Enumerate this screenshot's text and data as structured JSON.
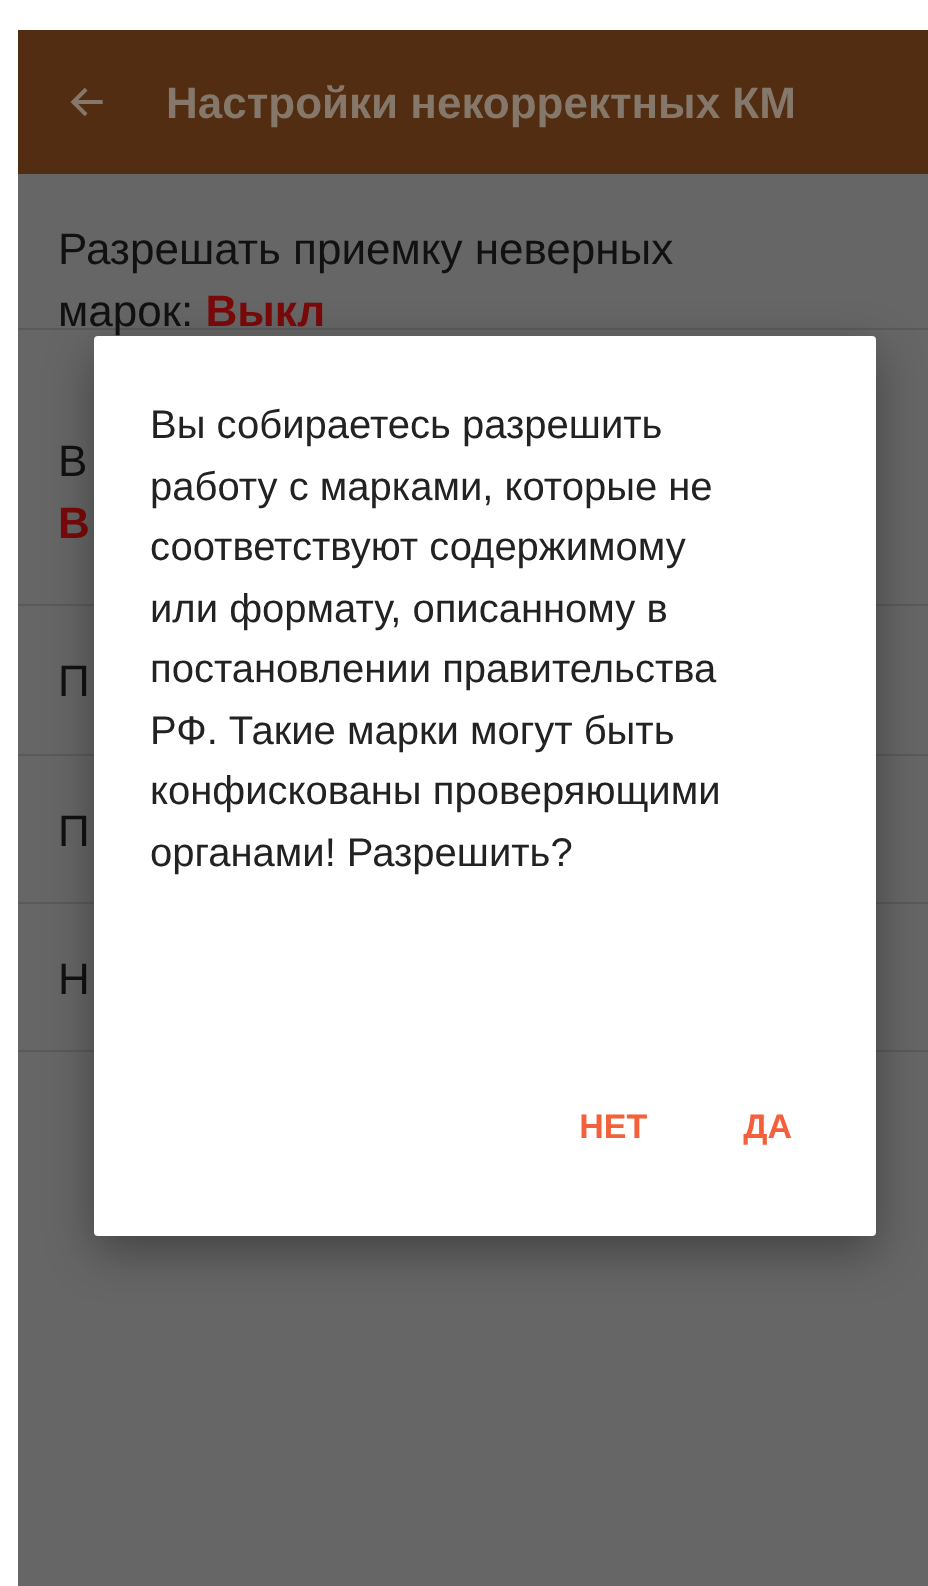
{
  "app_bar": {
    "title": "Настройки некорректных КМ"
  },
  "settings": [
    {
      "label": "Разрешать приемку неверных марок: ",
      "value": "Выкл"
    },
    {
      "label": "В",
      "value": "В"
    },
    {
      "label": "П"
    },
    {
      "label": "П"
    },
    {
      "label": "Н"
    }
  ],
  "dialog": {
    "message": "Вы собираетесь разрешить работу с марками, которые не соответствуют содержимому или формату, описанному в постановлении правительства РФ. Такие марки могут быть конфискованы проверяющими органами! Разрешить?",
    "buttons": [
      "НЕТ",
      "ДА"
    ]
  }
}
